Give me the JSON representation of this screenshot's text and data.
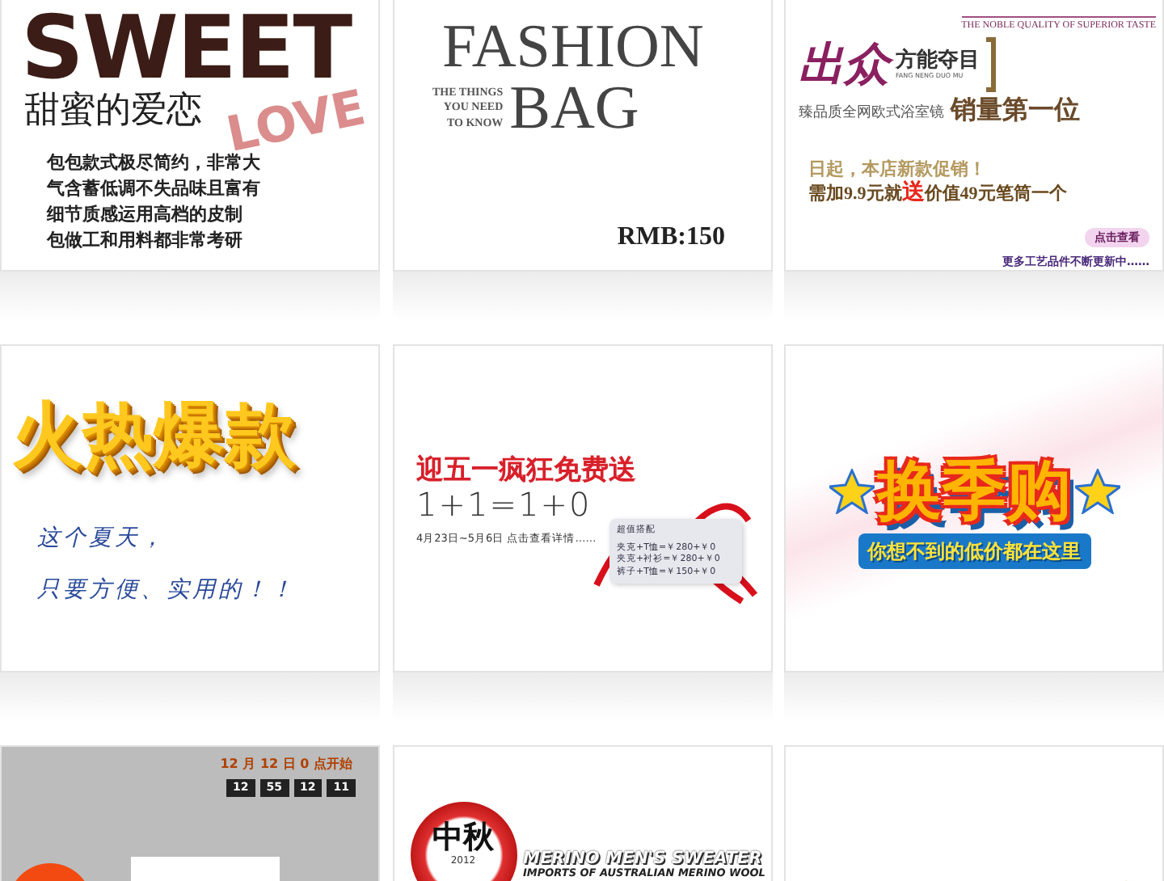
{
  "cards": [
    {
      "kind": "sweet",
      "title": "SWEET",
      "subtitle": "甜蜜的爱恋",
      "accent": "LOVE",
      "lines": [
        "包包款式极尽简约，非常大",
        "气含蓄低调不失品味且富有",
        "细节质感运用高档的皮制",
        "包做工和用料都非常考研"
      ]
    },
    {
      "kind": "fashion",
      "title_1": "FASHION",
      "title_2": "BAG",
      "tagline": [
        "THE THINGS",
        "YOU NEED",
        "TO KNOW"
      ],
      "price": "RMB:150"
    },
    {
      "kind": "mirror",
      "tagline": "THE NOBLE QUALITY OF SUPERIOR TASTE",
      "logo": "出众",
      "slogan": "方能夺目",
      "pinyin": "FANG NENG DUO MU",
      "headline": "臻品质全网欧式浴室镜",
      "highlight": "销量第一位",
      "promo_1": "日起，本店新款促销！",
      "promo_2": "需加9.9元就**送**价值49元笔筒一个",
      "button": "点击查看",
      "note": "更多工艺品件不断更新中……"
    },
    {
      "kind": "hot",
      "title": "火热爆款",
      "lines": [
        "这个夏天，",
        "只要方便、实用的！！"
      ]
    },
    {
      "kind": "mayday",
      "title": "迎五一疯狂免费送",
      "formula": "1+1=1+0",
      "date": "4月23日~5月6日 点击查看详情……",
      "tag_title": "超值搭配",
      "tag_lines": [
        "夹克+T恤=￥280+￥0",
        "夹克+衬衫=￥280+￥0",
        "裤子+T恤=￥150+￥0"
      ]
    },
    {
      "kind": "season",
      "title": "换季购",
      "subtitle": "你想不到的低价都在这里"
    },
    {
      "kind": "countdown",
      "date": "12 月 12 日 0 点开始",
      "timer": [
        "12",
        "55",
        "12",
        "11"
      ]
    },
    {
      "kind": "midautumn",
      "badge": "中秋",
      "year": "2012",
      "title": "MERINO MEN'S SWEATER",
      "subtitle": "IMPORTS OF AUSTRALIAN MERINO WOOL"
    },
    {
      "kind": "gold"
    }
  ]
}
